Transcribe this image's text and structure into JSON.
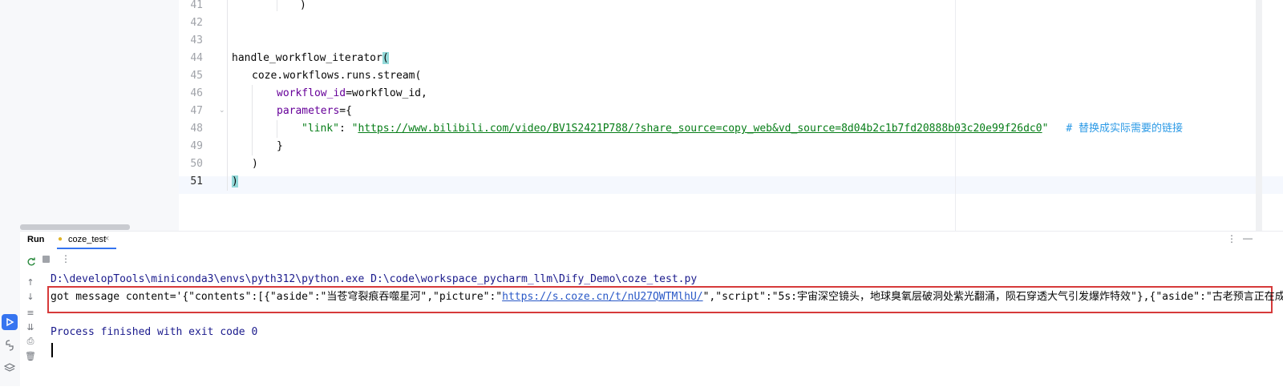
{
  "editor": {
    "line_numbers": [
      "41",
      "42",
      "43",
      "44",
      "45",
      "46",
      "47",
      "48",
      "49",
      "50",
      "51"
    ],
    "lines": {
      "l41": ")",
      "l44_fn": "handle_workflow_iterator",
      "l44_paren": "(",
      "l45": "coze.workflows.runs.stream(",
      "l46_kw": "workflow_id",
      "l46_rest": "=workflow_id,",
      "l47_kw": "parameters",
      "l47_rest": "={",
      "l48_key": "\"link\"",
      "l48_colon": ": ",
      "l48_q1": "\"",
      "l48_url": "https://www.bilibili.com/video/BV1S2421P788/?share_source=copy_web&vd_source=8d04b2c1b7fd20888b03c20e99f26dc0",
      "l48_q2": "\"",
      "l48_comment_hash": "# ",
      "l48_comment_text": "替换成实际需要的链接",
      "l49": "}",
      "l50": ")",
      "l51": ")"
    }
  },
  "run_panel": {
    "title": "Run",
    "tab_label": "coze_test",
    "console": {
      "command_line": "D:\\developTools\\miniconda3\\envs\\pyth312\\python.exe D:\\code\\workspace_pycharm_llm\\Dify_Demo\\coze_test.py",
      "msg_part1": "got message content='{\"contents\":[{\"aside\":\"",
      "msg_cn1": "当苍穹裂痕吞噬星河",
      "msg_part2": "\",\"picture\":\"",
      "msg_link": "https://s.coze.cn/t/nU27QWTMlhU/",
      "msg_part3": "\",\"script\":\"5s:",
      "msg_cn2": "宇宙深空镜头，地球臭氧层破洞处紫光翻涌，陨石穿透大气引发爆炸特效",
      "msg_part4": "\"},{\"aside\":\"",
      "msg_cn3": "古老预言正在成为",
      "exit_line": "Process finished with exit code 0"
    }
  },
  "colors": {
    "highlight_box": "#d63a3a",
    "accent": "#3574f0",
    "string": "#067d17",
    "param_keyword": "#660099"
  }
}
